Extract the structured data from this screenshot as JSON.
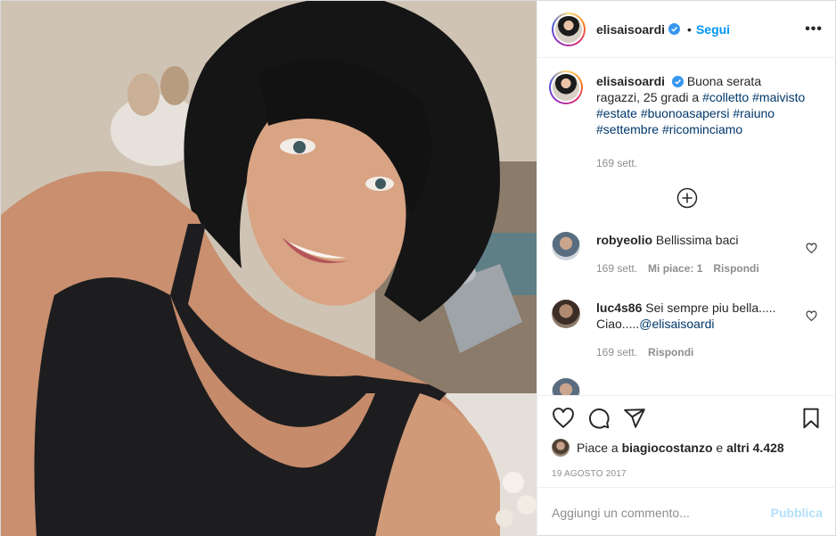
{
  "header": {
    "username": "elisaisoardi",
    "verified_icon": "verified-badge-icon",
    "follow_label": "Segui",
    "dot": "•",
    "more_icon": "more-options-icon",
    "more_glyph": "•••"
  },
  "caption": {
    "username": "elisaisoardi",
    "text": "Buona serata ragazzi, 25 gradi a",
    "hashtags": [
      "#colletto",
      "#maivisto",
      "#estate",
      "#buonoasapersi",
      "#raiuno",
      "#settembre",
      "#ricominciamo"
    ],
    "time": "169 sett."
  },
  "comments": [
    {
      "username": "robyeolio",
      "text": "Bellissima baci",
      "time": "169 sett.",
      "likes": "Mi piace: 1",
      "reply": "Rispondi"
    },
    {
      "username": "luc4s86",
      "text": "Sei sempre piu bella..... Ciao.....",
      "mention": "@elisaisoardi",
      "time": "169 sett.",
      "reply": "Rispondi"
    }
  ],
  "actions": {
    "like_icon": "heart-icon",
    "comment_icon": "comment-icon",
    "share_icon": "share-icon",
    "save_icon": "bookmark-icon"
  },
  "likes": {
    "prefix": "Piace a",
    "user": "biagiocostanzo",
    "middle": "e",
    "others": "altri 4.428"
  },
  "date": "19 AGOSTO 2017",
  "add_comment": {
    "placeholder": "Aggiungi un commento...",
    "publish_label": "Pubblica"
  },
  "colors": {
    "accent": "#0095f6",
    "hashtag": "#00376b",
    "muted": "#8e8e8e",
    "publish_disabled": "#b2dffc"
  }
}
